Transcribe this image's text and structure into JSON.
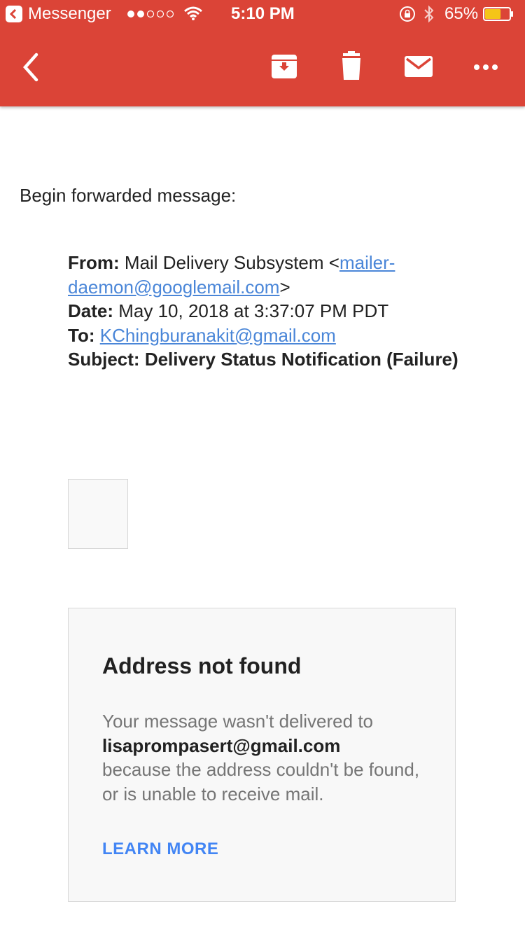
{
  "status_bar": {
    "back_app": "Messenger",
    "time": "5:10 PM",
    "battery_percent": "65%",
    "battery_level": 0.65
  },
  "colors": {
    "app_bar": "#db4437",
    "link": "#4a86d8",
    "learn_more": "#4285f4",
    "battery_fill": "#f5c518"
  },
  "toolbar": {
    "icons": [
      "back-arrow-icon",
      "archive-icon",
      "delete-icon",
      "mail-icon",
      "more-icon"
    ]
  },
  "email": {
    "intro": "Begin forwarded message:",
    "from_label": "From:",
    "from_name": "Mail Delivery Subsystem <",
    "from_email": "mailer-daemon@googlemail.com",
    "from_close": ">",
    "date_label": "Date:",
    "date_value": "May 10, 2018 at 3:37:07 PM PDT",
    "to_label": "To:",
    "to_email": "KChingburanakit@gmail.com",
    "subject_label": "Subject:",
    "subject_value": "Delivery Status Notification (Failure)"
  },
  "card": {
    "title": "Address not found",
    "body_before": "Your message wasn't delivered to",
    "address": "lisaprompasert@gmail.com",
    "body_after": "because the address couldn't be found, or is unable to receive mail.",
    "link": "LEARN MORE"
  }
}
